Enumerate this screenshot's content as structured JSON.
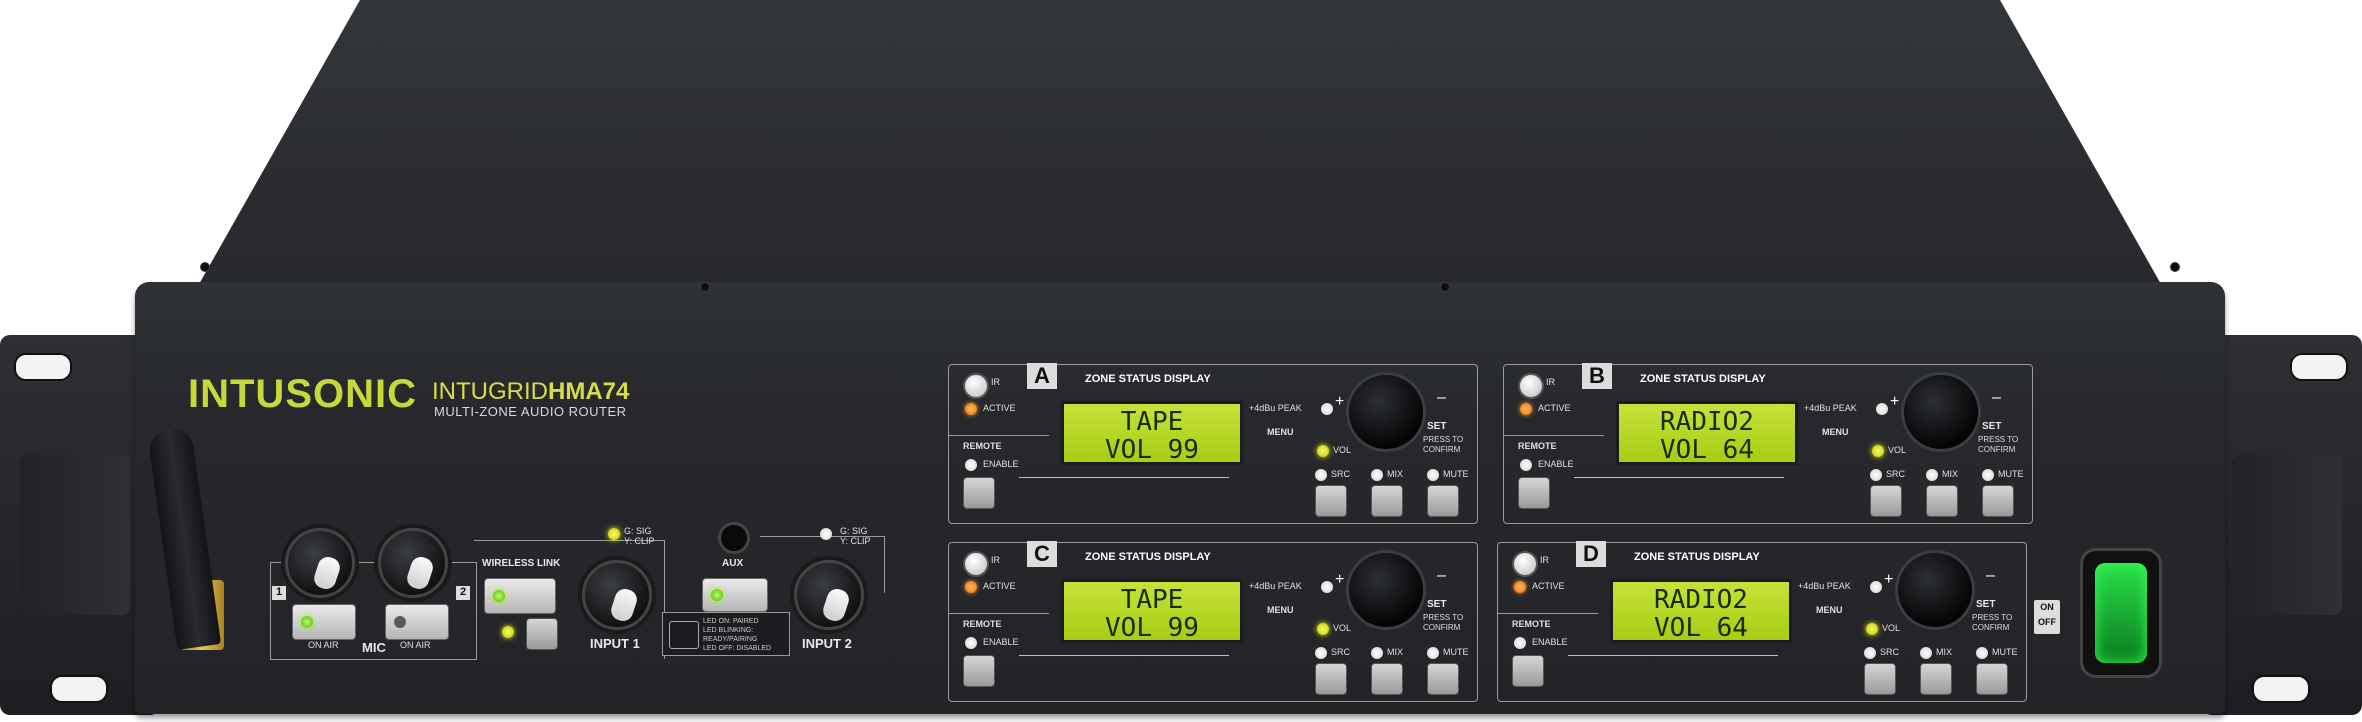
{
  "brand": {
    "logo": "INTUSONIC",
    "model_prefix": "INTUGRID",
    "model": "HMA74",
    "subtitle": "MULTI-ZONE AUDIO ROUTER"
  },
  "mic_section": {
    "label": "MIC",
    "ch1": "1",
    "ch2": "2",
    "onair1": "ON AIR",
    "onair2": "ON AIR"
  },
  "wireless": {
    "label": "WIRELESS LINK",
    "sig": "G: SIG",
    "clip": "Y: CLIP",
    "input_label": "INPUT 1",
    "legend": [
      "LED ON: PAIRED",
      "LED BLINKING: READY/PAIRING",
      "LED OFF: DISABLED"
    ]
  },
  "aux": {
    "label": "AUX",
    "sig": "G: SIG",
    "clip": "Y: CLIP",
    "input_label": "INPUT 2"
  },
  "zone_labels": {
    "title": "ZONE STATUS DISPLAY",
    "ir": "IR",
    "active": "ACTIVE",
    "remote": "REMOTE",
    "enable": "ENABLE",
    "peak": "+4dBu PEAK",
    "plus": "+",
    "minus": "–",
    "menu": "MENU",
    "vol": "VOL",
    "set": "SET",
    "press": "PRESS TO",
    "confirm": "CONFIRM",
    "src": "SRC",
    "mix": "MIX",
    "mute": "MUTE"
  },
  "zones": [
    {
      "letter": "A",
      "line1": "TAPE",
      "line2": "VOL 99"
    },
    {
      "letter": "B",
      "line1": "RADIO2",
      "line2": "VOL 64"
    },
    {
      "letter": "C",
      "line1": "TAPE",
      "line2": "VOL 99"
    },
    {
      "letter": "D",
      "line1": "RADIO2",
      "line2": "VOL 64"
    }
  ],
  "power": {
    "on": "ON",
    "off": "OFF"
  },
  "colors": {
    "accent": "#c6d83a",
    "lcd": "#b6d622",
    "panel": "#26282c"
  }
}
